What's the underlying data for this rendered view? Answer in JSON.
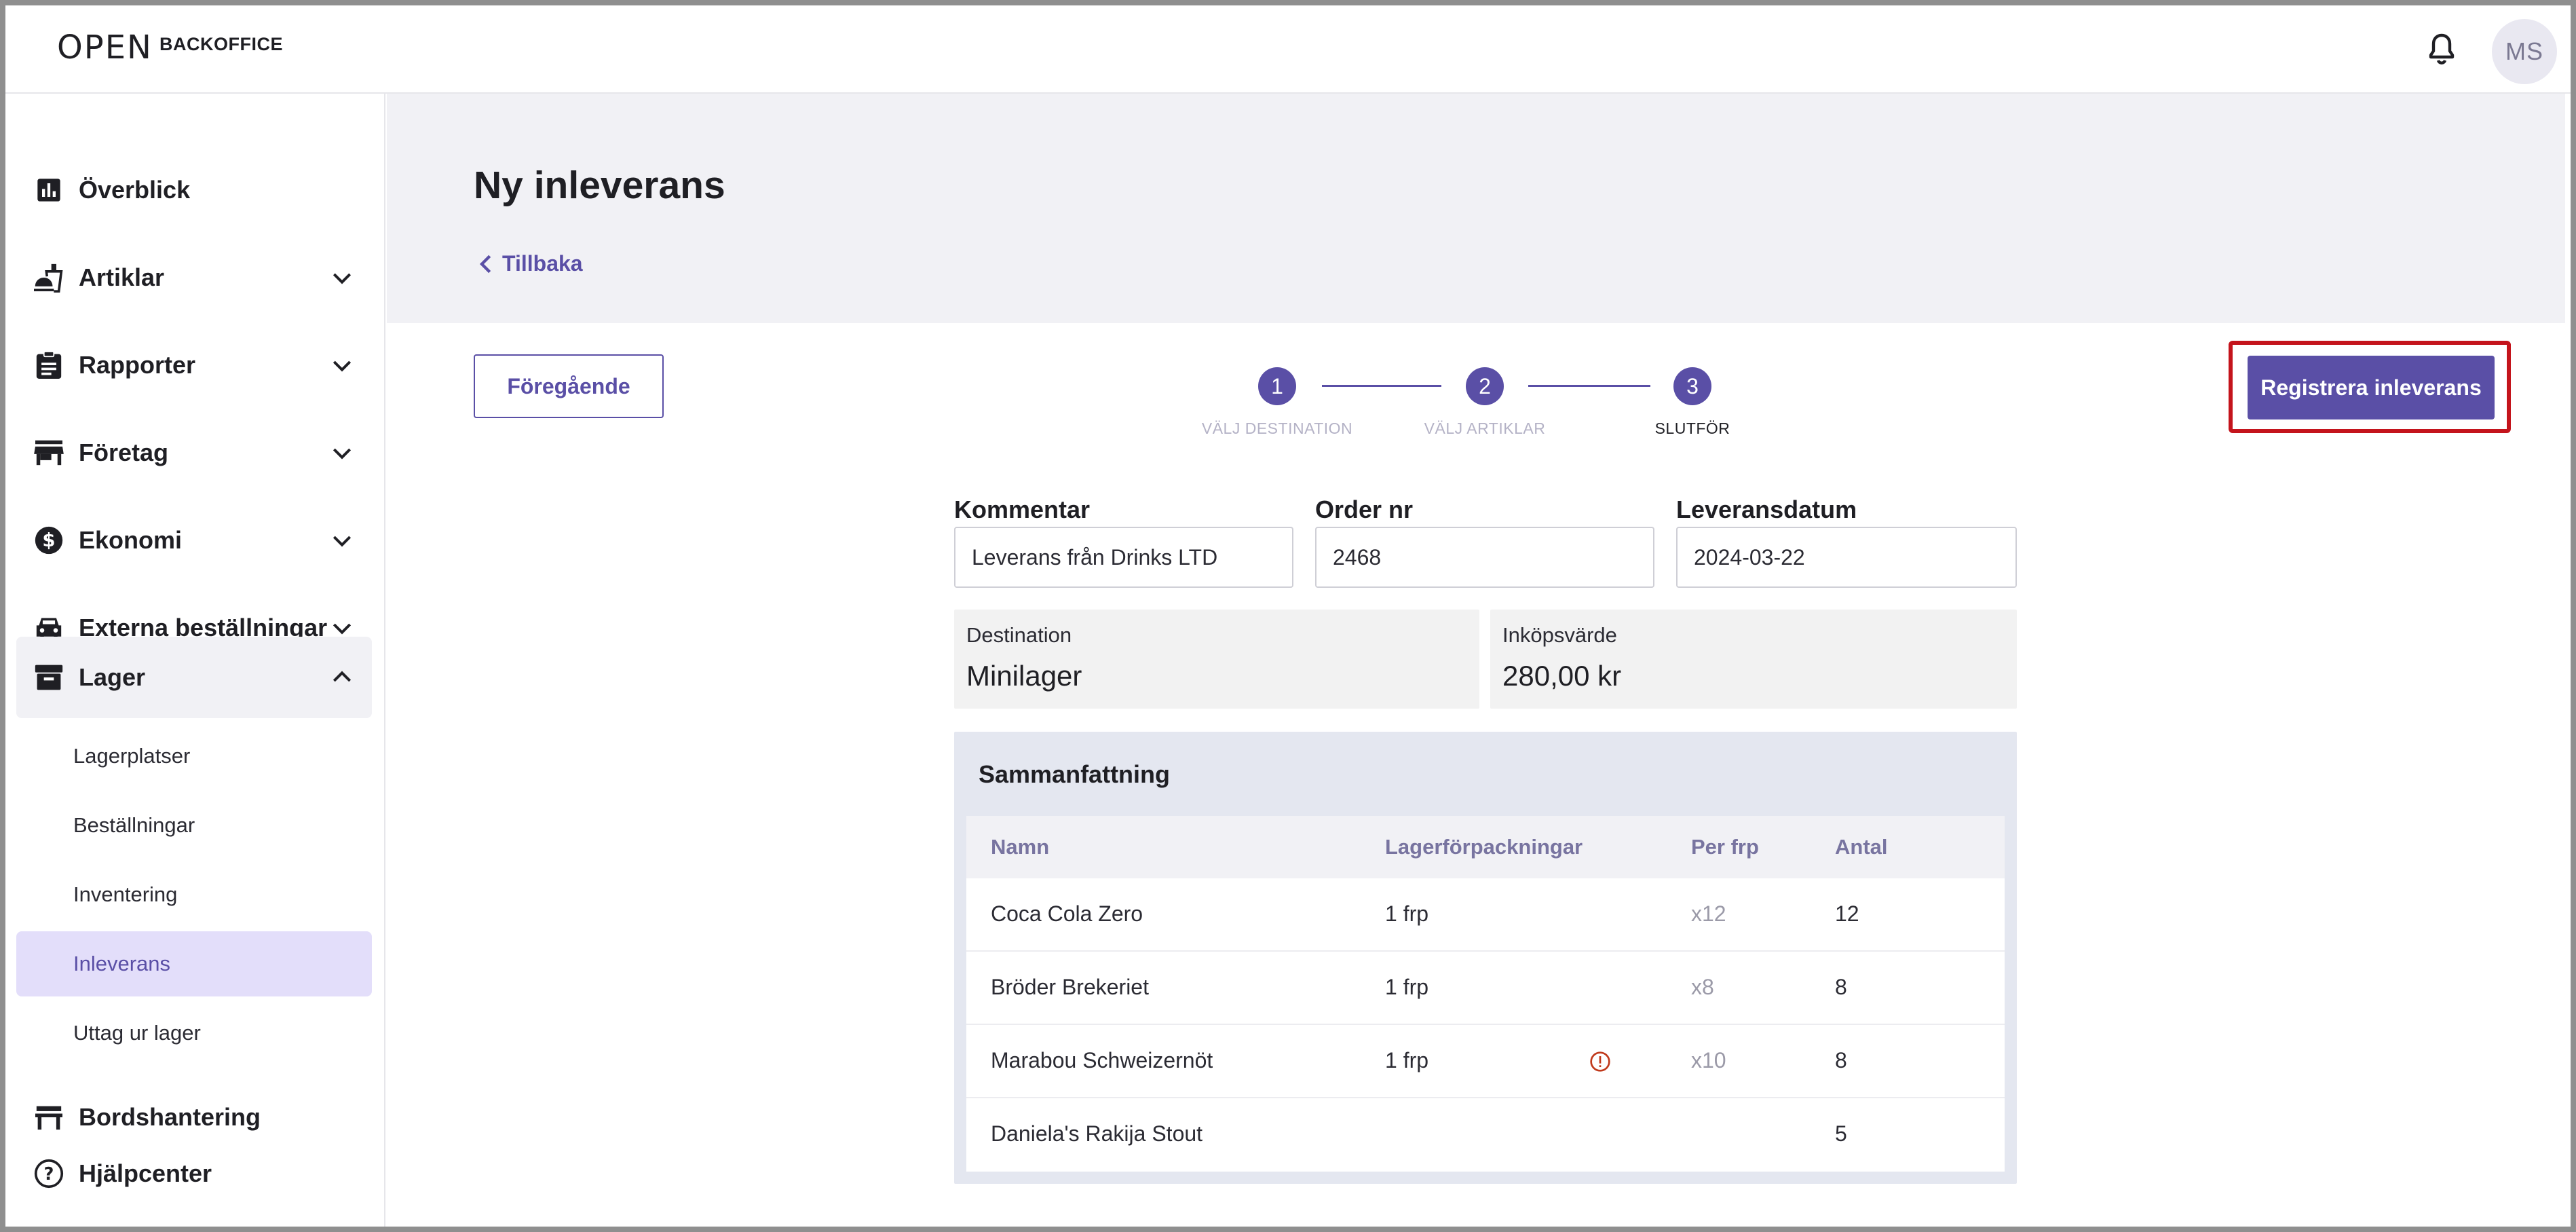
{
  "topbar": {
    "logo_text": "OPEN",
    "logo_suffix": "BACKOFFICE",
    "bell_icon": "bell-icon",
    "avatar_initials": "MS"
  },
  "sidebar": {
    "items": [
      {
        "label": "Överblick",
        "icon": "bar-chart-icon"
      },
      {
        "label": "Artiklar",
        "icon": "food-icon"
      },
      {
        "label": "Rapporter",
        "icon": "clipboard-icon"
      },
      {
        "label": "Företag",
        "icon": "store-icon"
      },
      {
        "label": "Ekonomi",
        "icon": "dollar-icon"
      },
      {
        "label": "Externa beställningar",
        "icon": "car-icon"
      },
      {
        "label": "Lager",
        "icon": "archive-icon"
      }
    ],
    "sub_items": [
      {
        "label": "Lagerplatser"
      },
      {
        "label": "Beställningar"
      },
      {
        "label": "Inventering"
      },
      {
        "label": "Inleverans"
      },
      {
        "label": "Uttag ur lager"
      }
    ],
    "bottom_items": [
      {
        "label": "Bordshantering",
        "icon": "table-icon"
      },
      {
        "label": "Hjälpcenter",
        "icon": "help-icon"
      }
    ]
  },
  "page": {
    "title": "Ny inleverans",
    "back_label": "Tillbaka",
    "prev_button": "Föregående",
    "register_button": "Registrera inleverans"
  },
  "stepper": {
    "steps": [
      {
        "number": "1",
        "label": "VÄLJ DESTINATION"
      },
      {
        "number": "2",
        "label": "VÄLJ ARTIKLAR"
      },
      {
        "number": "3",
        "label": "SLUTFÖR"
      }
    ],
    "current_step": 3
  },
  "form": {
    "comment_label": "Kommentar",
    "comment_value": "Leverans från Drinks LTD",
    "order_label": "Order nr",
    "order_value": "2468",
    "date_label": "Leveransdatum",
    "date_value": "2024-03-22"
  },
  "info": {
    "destination_label": "Destination",
    "destination_value": "Minilager",
    "purchase_label": "Inköpsvärde",
    "purchase_value": "280,00 kr"
  },
  "summary": {
    "title": "Sammanfattning",
    "columns": [
      "Namn",
      "Lagerförpackningar",
      "Per frp",
      "Antal"
    ],
    "rows": [
      {
        "name": "Coca Cola Zero",
        "packages": "1 frp",
        "per": "x12",
        "qty": "12",
        "warning": false
      },
      {
        "name": "Bröder Brekeriet",
        "packages": "1 frp",
        "per": "x8",
        "qty": "8",
        "warning": false
      },
      {
        "name": "Marabou Schweizernöt",
        "packages": "1 frp",
        "per": "x10",
        "qty": "8",
        "warning": true
      },
      {
        "name": "Daniela's Rakija Stout",
        "packages": "",
        "per": "",
        "qty": "5",
        "warning": false
      }
    ]
  },
  "colors": {
    "accent": "#5a4fa6",
    "highlight": "#c4141c",
    "warning": "#c0391b"
  }
}
